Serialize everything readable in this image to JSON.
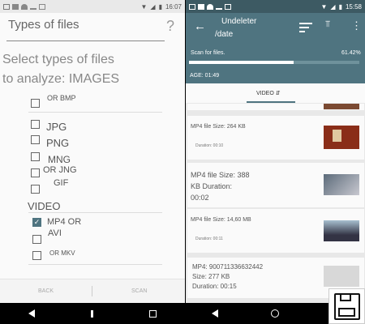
{
  "left": {
    "status": {
      "time": "16:07"
    },
    "title": "Types of files",
    "help": "?",
    "heading_line1": "Select types of files",
    "heading_line2": "to analyze: IMAGES",
    "items": [
      {
        "label": "OR BMP",
        "checked": false
      },
      {
        "label": "JPG",
        "checked": false
      },
      {
        "label": "PNG",
        "checked": false
      },
      {
        "label": "MNG",
        "checked": false
      },
      {
        "label": "OR JNG",
        "checked": false
      },
      {
        "label": "GIF",
        "checked": false
      }
    ],
    "video_section": "VIDEO",
    "video_items": [
      {
        "label": "MP4 OR",
        "sub": "AVI",
        "checked": true
      },
      {
        "label": "",
        "checked": false
      },
      {
        "label": "OR MKV",
        "checked": false
      }
    ],
    "back": "BACK",
    "scan": "SCAN"
  },
  "right": {
    "status": {
      "time": "15:58"
    },
    "app_title": "Undeleter",
    "path": "/date",
    "scan_text": "Scan for files.",
    "scan_percent": "61.42%",
    "scan_progress": 61.42,
    "age": "AGE: 01:49",
    "tab": "VIDEO",
    "files": [
      {
        "line1": "MP4 file Size: 264 KB",
        "line2": "Duration: 00:10",
        "size": "small"
      },
      {
        "line1": "MP4 file Size: 388",
        "line2": "KB Duration:",
        "line3": "00:02",
        "size": "large"
      },
      {
        "line1": "MP4 file Size: 14,60 MB",
        "line2": "Duration: 00:11",
        "size": "small"
      },
      {
        "line1": "MP4: 900711336632442",
        "line2": "Size: 277 KB",
        "line3": "Duration: 00:15",
        "size": "large"
      }
    ]
  },
  "colors": {
    "toolbar": "#4f7480",
    "statusbar": "#3d5a63",
    "check": "#4f7480"
  }
}
